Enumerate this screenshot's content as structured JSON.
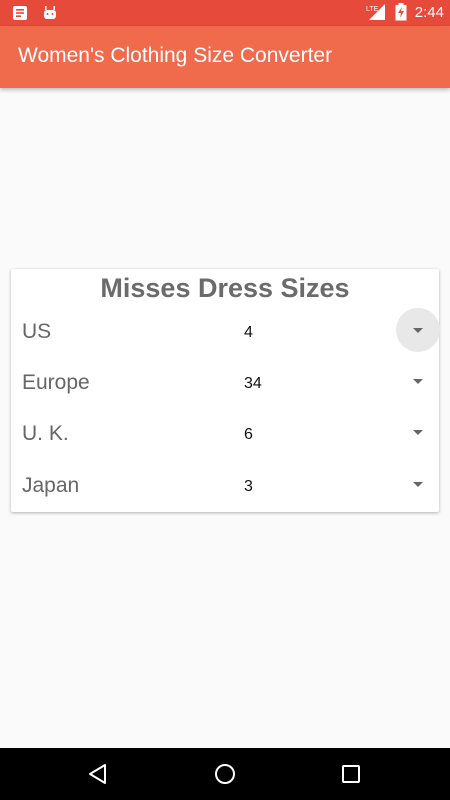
{
  "status_bar": {
    "time": "2:44",
    "network": "LTE",
    "icons": [
      "notification-icon",
      "android-icon",
      "signal-icon",
      "battery-icon"
    ]
  },
  "app_bar": {
    "title": "Women's Clothing Size Converter",
    "color": "#f06b4c"
  },
  "card": {
    "title": "Misses Dress Sizes",
    "rows": [
      {
        "label": "US",
        "value": "4"
      },
      {
        "label": "Europe",
        "value": "34"
      },
      {
        "label": "U. K.",
        "value": "6"
      },
      {
        "label": "Japan",
        "value": "3"
      }
    ]
  },
  "nav_bar": {
    "buttons": [
      "back-icon",
      "home-icon",
      "recents-icon"
    ]
  }
}
